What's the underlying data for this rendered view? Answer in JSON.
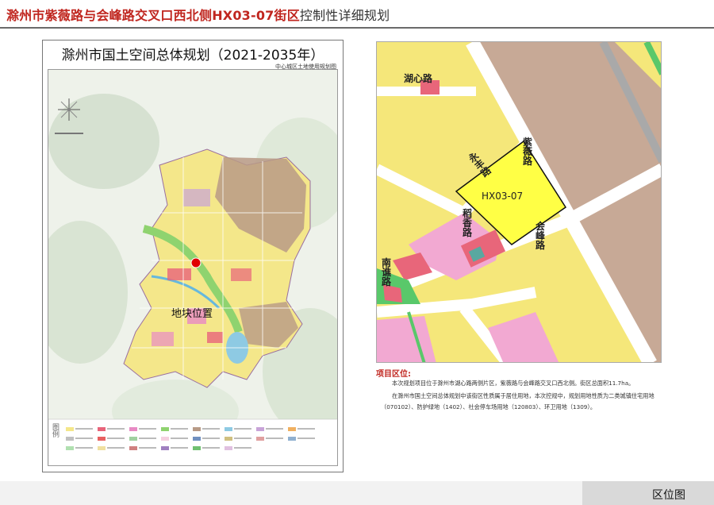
{
  "header": {
    "title_highlight": "滁州市紫薇路与会峰路交叉口西北侧HX03-07街区",
    "title_rest": "控制性详细规划"
  },
  "left_map": {
    "title": "滁州市国土空间总体规划（2021-2035年）",
    "subtitle": "中心城区土地使用规划图",
    "site_label": "地块位置",
    "legend_label": "图例",
    "colors": {
      "residential": "#f5e77a",
      "commercial": "#e8647a",
      "industrial": "#b89a86",
      "green": "#8fd36f",
      "water": "#8ecae3",
      "public": "#e88ac4",
      "terrain": "#d7e3cf",
      "marker": "#e00000"
    }
  },
  "right_map": {
    "roads": {
      "hu_xin": "湖心路",
      "zi_wei": "紫薇路",
      "yong_feng": "永丰路",
      "dao_xiang": "稻香路",
      "hui_feng": "会峰路",
      "nan_qiao": "南谯路"
    },
    "parcel_label": "HX03-07",
    "colors": {
      "residential": "#f5e77a",
      "parcel": "#ffff45",
      "industrial": "#c7a996",
      "commercial": "#e8667a",
      "pink": "#f2a9d2",
      "green": "#59c86a",
      "road": "#ffffff",
      "rail": "#a9a9a9"
    }
  },
  "description": {
    "heading": "项目区位:",
    "p1": "本次规划项目位于滁州市湖心路两侧片区，紫薇路与会峰路交叉口西北侧。街区总面积11.7ha。",
    "p2": "在滁州市国土空间总体规划中该街区性质属于居住用地，本次控规中，规划用地性质为二类城镇住宅用地",
    "p3": "（070102）、防护绿地（1402）、社会停车场用地（120803）、环卫用地（1309）。"
  },
  "footer": {
    "label": "区位图"
  }
}
